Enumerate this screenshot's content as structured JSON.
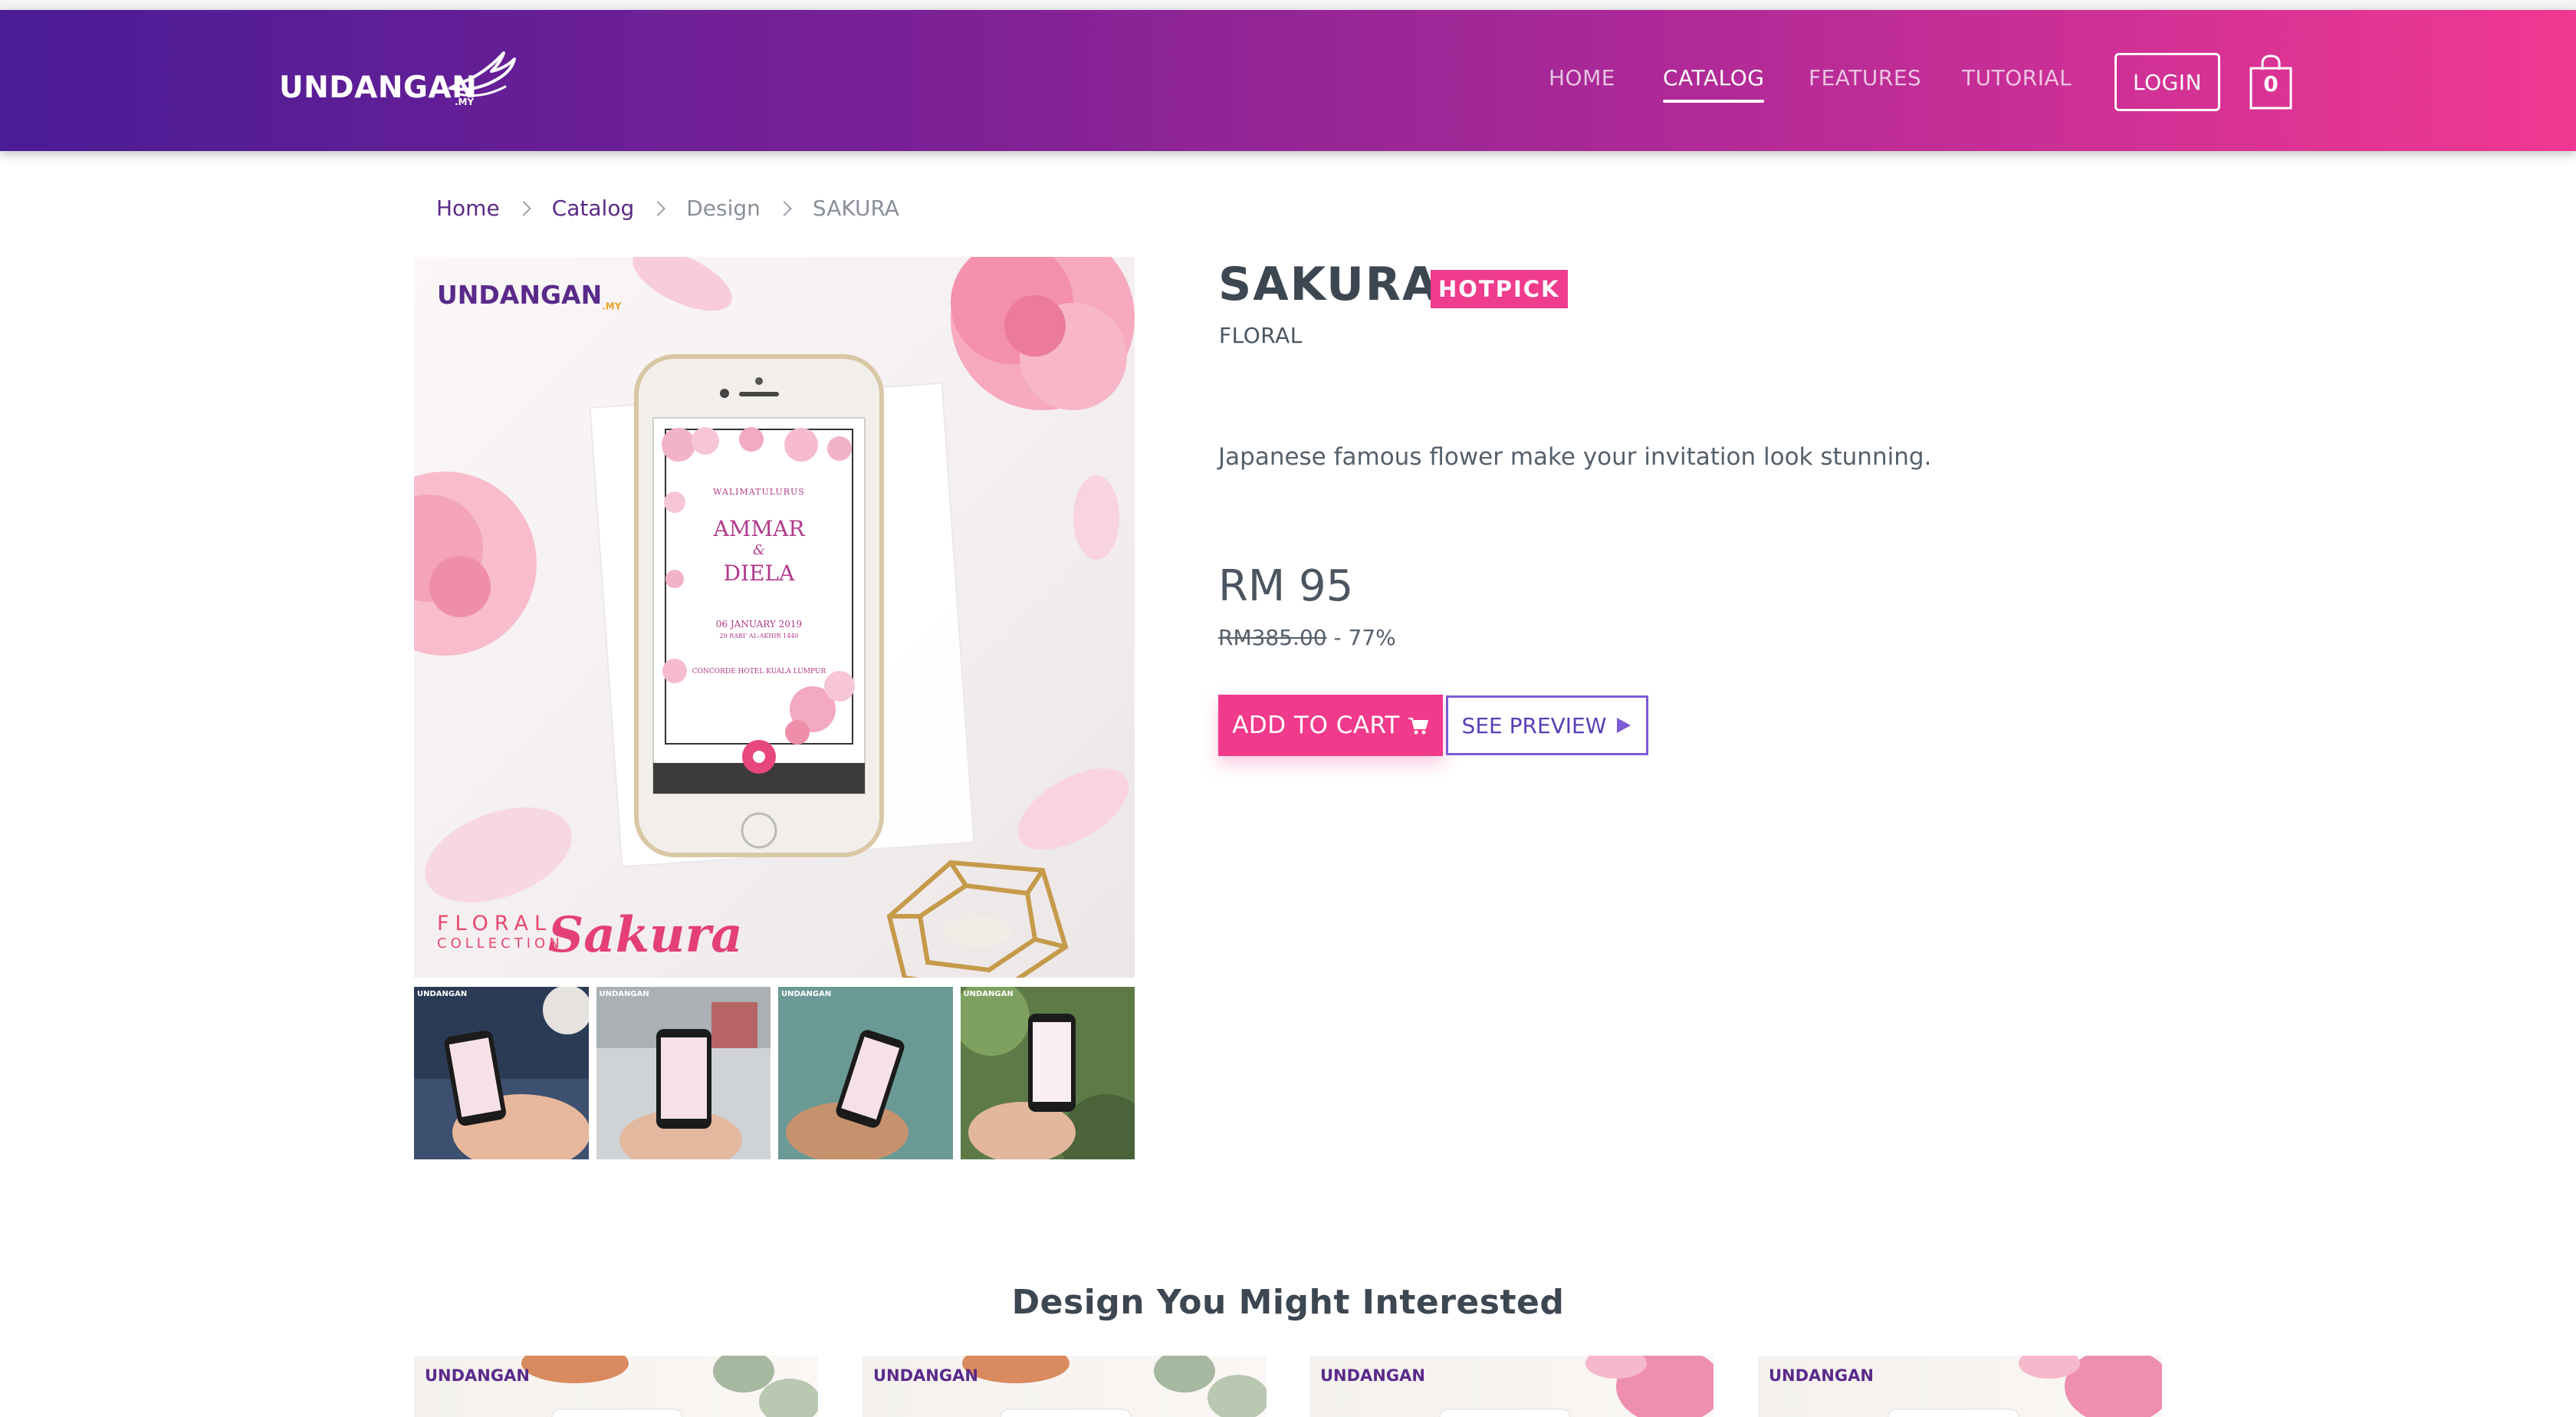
{
  "header": {
    "logo_text": "UNDANGAN",
    "nav": [
      "HOME",
      "CATALOG",
      "FEATURES",
      "TUTORIAL"
    ],
    "active_nav": "CATALOG",
    "login_label": "LOGIN",
    "cart_count": "0"
  },
  "breadcrumb": {
    "home": "Home",
    "catalog": "Catalog",
    "design": "Design",
    "current": "SAKURA"
  },
  "gallery": {
    "image_logo": "UNDANGAN",
    "image_logo_suffix": ".MY",
    "phone_preheading": "WALIMATULURUS",
    "groom": "AMMAR",
    "ampersand": "&",
    "bride": "DIELA",
    "date": "06 JANUARY 2019",
    "hijri": "29 RABI' AL-AKHIR 1440",
    "venue": "CONCORDE HOTEL KUALA LUMPUR",
    "collection_top": "FLORAL",
    "collection_bottom": "COLLECTION",
    "collection_script": "Sakura",
    "thumb_logo": "UNDANGAN"
  },
  "product": {
    "title": "SAKURA",
    "badge": "HOTPICK",
    "category": "FLORAL",
    "description": "Japanese famous flower make your invitation look stunning.",
    "price": "RM 95",
    "old_price": "RM385.00",
    "discount": " - 77%",
    "add_to_cart": "ADD TO CART",
    "see_preview": "SEE PREVIEW"
  },
  "related": {
    "title": "Design You Might Interested",
    "card_logo": "UNDANGAN"
  },
  "colors": {
    "header_start": "#4a1c96",
    "header_end": "#f13892",
    "accent_pink": "#f23a8c",
    "accent_purple": "#7d5cd6"
  }
}
